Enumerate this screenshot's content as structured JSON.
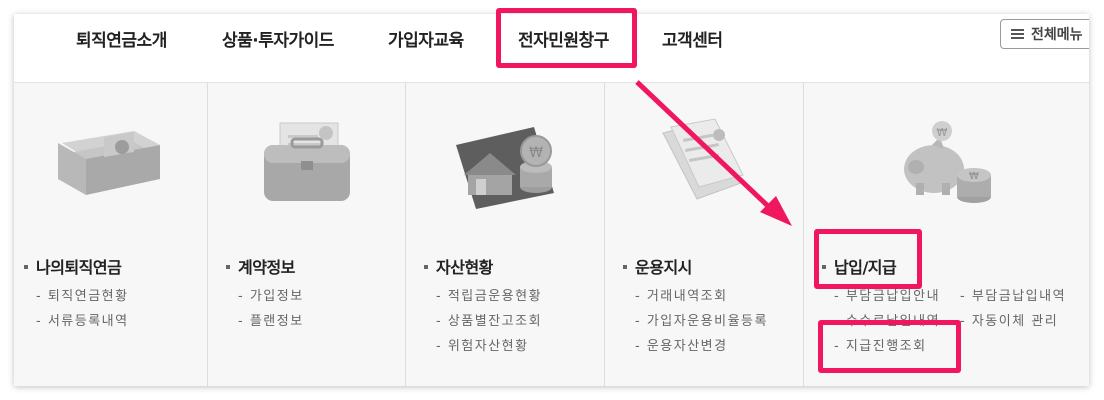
{
  "nav": {
    "items": [
      "퇴직연금소개",
      "상품·투자가이드",
      "가입자교육",
      "전자민원창구",
      "고객센터"
    ],
    "menu_button": "전체메뉴"
  },
  "columns": [
    {
      "title": "나의퇴직연금",
      "icon": "money-stack-icon",
      "links": [
        "퇴직연금현황",
        "서류등록내역"
      ]
    },
    {
      "title": "계약정보",
      "icon": "briefcase-icon",
      "links": [
        "가입정보",
        "플랜정보"
      ]
    },
    {
      "title": "자산현황",
      "icon": "house-coins-icon",
      "links": [
        "적립금운용현황",
        "상품별잔고조회",
        "위험자산현황"
      ]
    },
    {
      "title": "운용지시",
      "icon": "document-icon",
      "links": [
        "거래내역조회",
        "가입자운용비율등록",
        "운용자산변경"
      ]
    },
    {
      "title": "납입/지급",
      "icon": "piggy-bank-icon",
      "links": [
        "부담금납입안내",
        "부담금납입내역",
        "수수료납입내역",
        "자동이체 관리",
        "지급진행조회"
      ]
    }
  ],
  "colors": {
    "highlight": "#f0175e",
    "panel_bg": "#f7f7f7",
    "icon_gray": "#b5b5b5"
  }
}
